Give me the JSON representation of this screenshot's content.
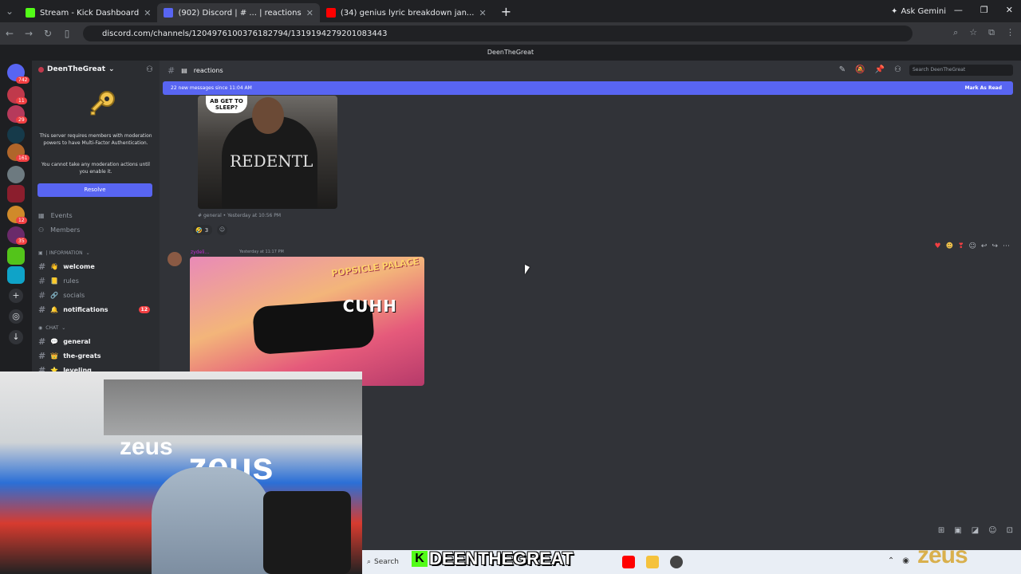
{
  "browser": {
    "tabs": [
      {
        "label": "Stream - Kick Dashboard",
        "color": "#53fc18",
        "active": false
      },
      {
        "label": "(902) Discord | # ... | reactions",
        "color": "#5865f2",
        "active": true
      },
      {
        "label": "(34) genius lyric breakdown jan...",
        "color": "#ff0000",
        "active": false
      }
    ],
    "gemini_label": "Ask Gemini",
    "url": "discord.com/channels/1204976100376182794/1319194279201083443"
  },
  "discord": {
    "title_bar": "DeenTheGreat",
    "server_name": "DeenTheGreat",
    "rail_badges": [
      "742",
      "11",
      "29",
      "161",
      "12",
      "35"
    ],
    "mfa": {
      "line1": "This server requires members with moderation powers to have Multi-Factor Authentication.",
      "line2": "You cannot take any moderation actions until you enable it.",
      "resolve_label": "Resolve"
    },
    "side_links": [
      {
        "label": "Events",
        "icon": "calendar-icon"
      },
      {
        "label": "Members",
        "icon": "members-icon"
      }
    ],
    "categories": {
      "information": "| INFORMATION",
      "chat": "CHAT"
    },
    "channels": [
      {
        "label": "welcome",
        "emoji": "👋",
        "bright": true
      },
      {
        "label": "rules",
        "emoji": "📒",
        "bright": false
      },
      {
        "label": "socials",
        "emoji": "🔗",
        "bright": false
      },
      {
        "label": "notifications",
        "emoji": "🔔",
        "bright": true,
        "mentions": "12"
      },
      {
        "label": "general",
        "emoji": "💬",
        "bright": true
      },
      {
        "label": "the-greats",
        "emoji": "👑",
        "bright": true
      },
      {
        "label": "leveling",
        "emoji": "⭐",
        "bright": true
      }
    ],
    "channel_header": "reactions",
    "search_placeholder": "Search DeenTheGreat",
    "new_messages": {
      "text": "22 new messages since 11:04 AM",
      "action": "Mark As Read"
    },
    "message1": {
      "bubble_text": "AB GET TO SLEEP?",
      "shirt_text": "REDENTL",
      "meta": "general  •  Yesterday at 10:56 PM",
      "reaction_emoji": "🤣",
      "reaction_count": "3"
    },
    "message2": {
      "author": "zydeli...",
      "time": "Yesterday at 11:17 PM",
      "image_label": "CUHH",
      "image_sign": "POPSICLE PALACE"
    }
  },
  "taskbar": {
    "search_label": "Search"
  },
  "overlay": {
    "k": "K",
    "name": "DEENTHEGREAT",
    "logo": "zeus"
  },
  "colors": {
    "discord_blurple": "#5865f2",
    "kick_green": "#53fc18",
    "mention_red": "#f23f42"
  }
}
